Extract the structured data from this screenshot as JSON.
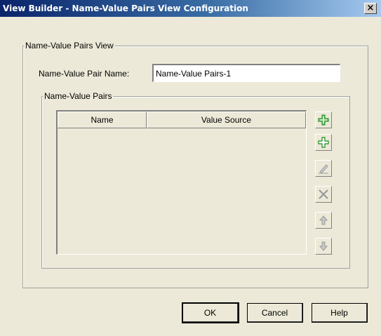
{
  "window": {
    "title": "View Builder - Name-Value Pairs View Configuration",
    "close_symbol": "×"
  },
  "outer_group": {
    "legend": "Name-Value Pairs View"
  },
  "name_field": {
    "label": "Name-Value Pair Name:",
    "value": "Name-Value Pairs-1"
  },
  "pairs_group": {
    "legend": "Name-Value Pairs",
    "columns": [
      "Name",
      "Value Source"
    ],
    "rows": []
  },
  "side_buttons": [
    {
      "name": "add-group-icon",
      "enabled": true
    },
    {
      "name": "add-icon",
      "enabled": true
    },
    {
      "name": "edit-icon",
      "enabled": false
    },
    {
      "name": "delete-icon",
      "enabled": false
    },
    {
      "name": "move-up-icon",
      "enabled": false
    },
    {
      "name": "move-down-icon",
      "enabled": false
    }
  ],
  "buttons": {
    "ok": "OK",
    "cancel": "Cancel",
    "help": "Help"
  },
  "colors": {
    "titlebar_start": "#0a246a",
    "titlebar_end": "#a6caf0",
    "dialog_bg": "#ece9d8",
    "add_icon_green": "#2ea043"
  }
}
